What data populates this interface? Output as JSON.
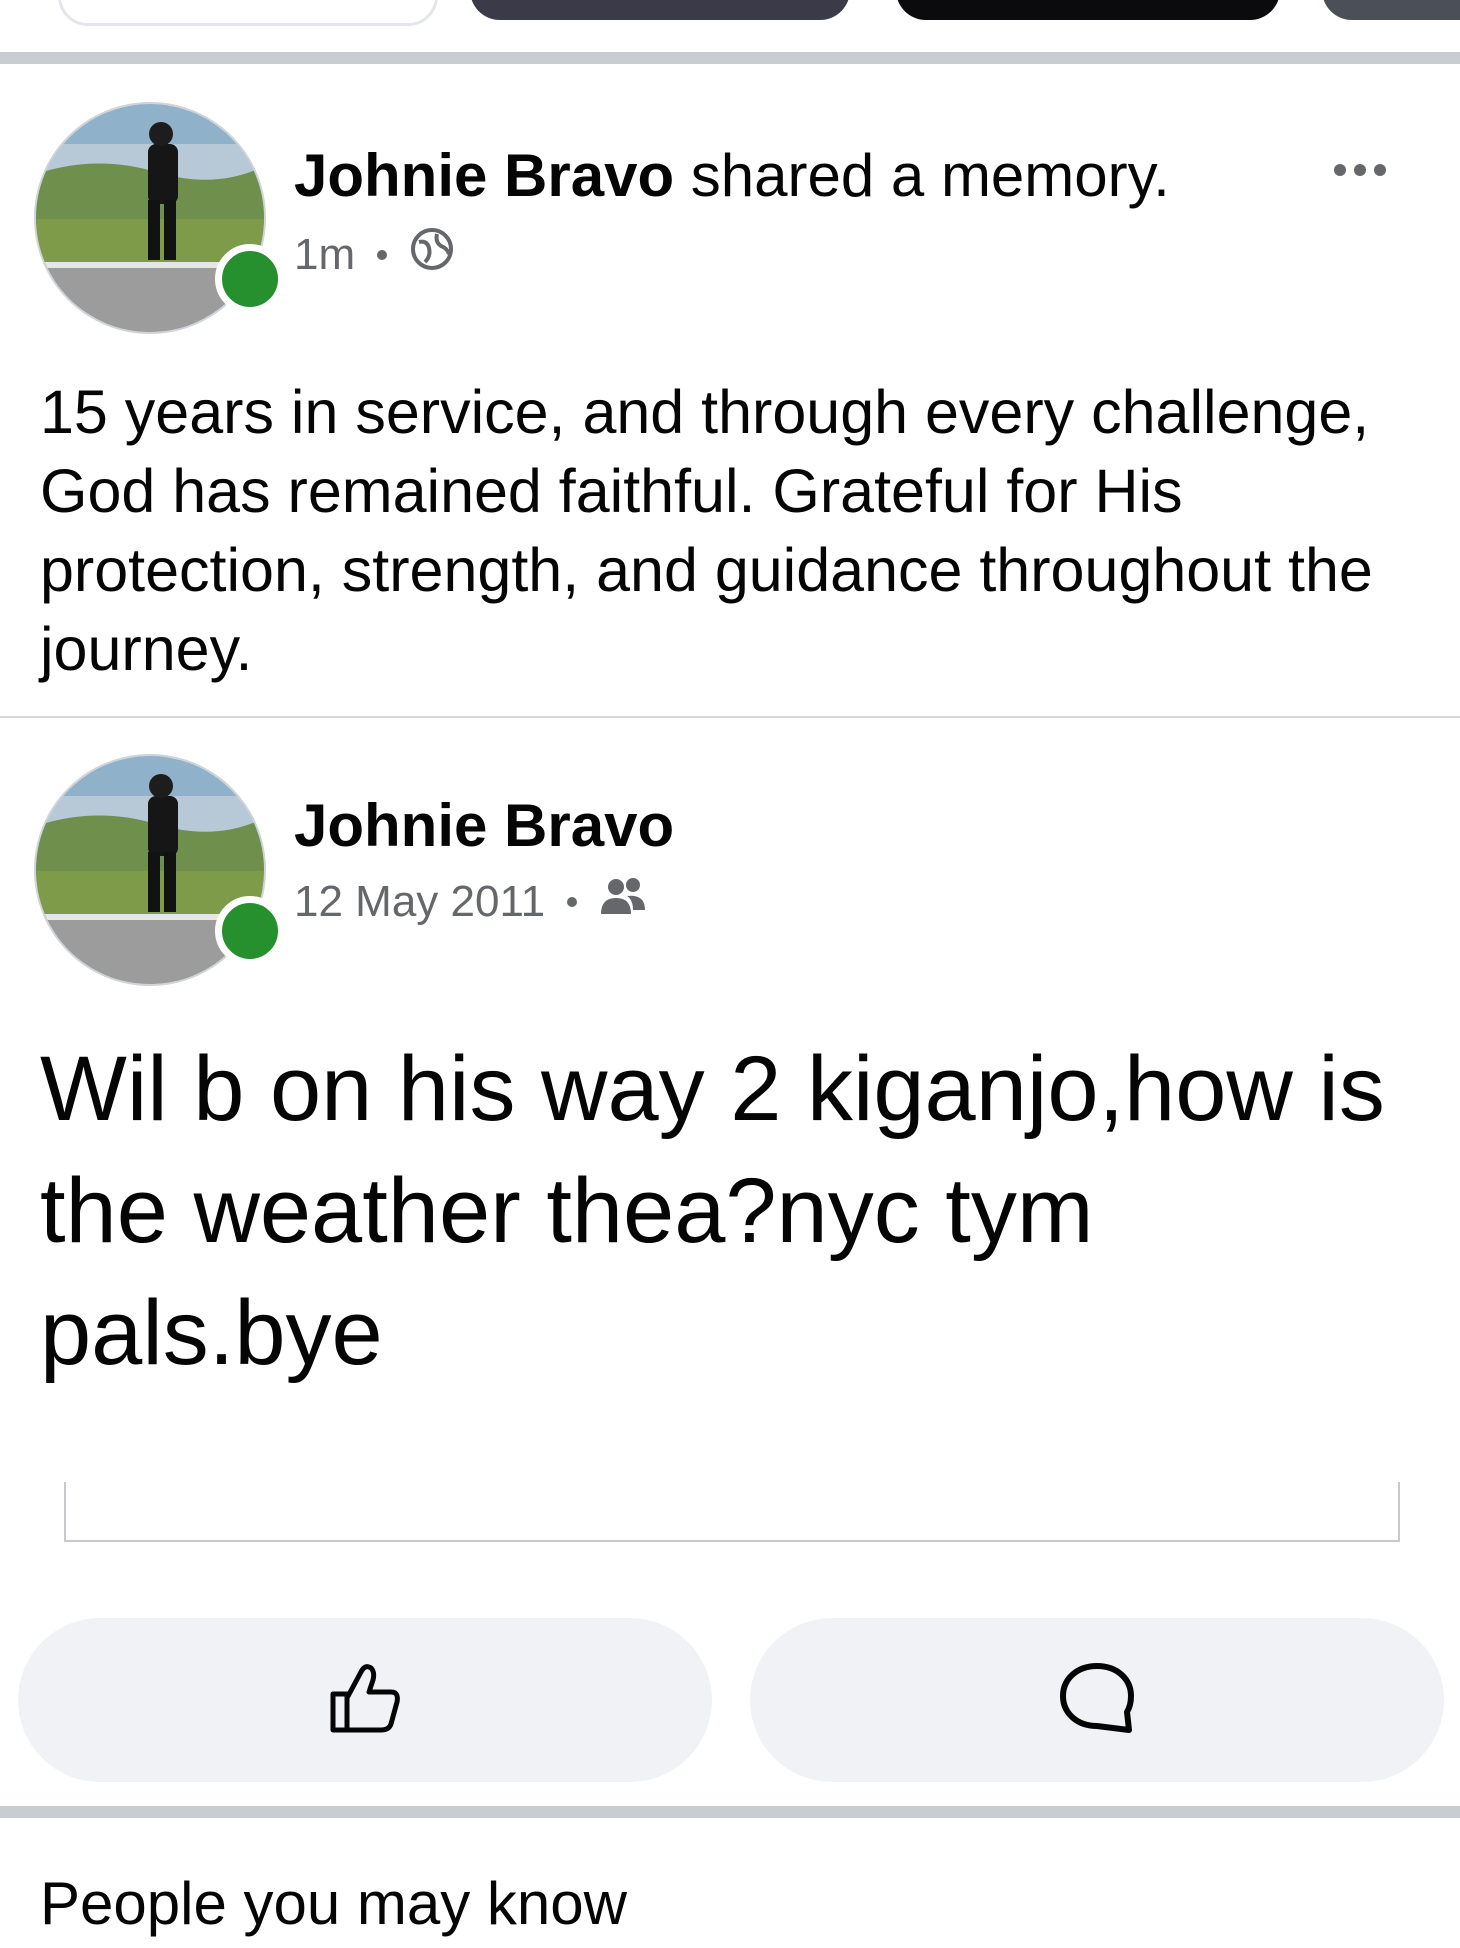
{
  "post1": {
    "author": "Johnie Bravo",
    "action_text": "shared a memory.",
    "time": "1m",
    "audience_icon": "globe-icon",
    "text": "15 years in service, and through every challenge, God has remained faithful. Grateful for His protection, strength, and guidance throughout the journey."
  },
  "post2": {
    "author": "Johnie Bravo",
    "date": "12 May 2011",
    "audience_icon": "friends-icon",
    "text": "Wil b on his way 2 kiganjo,how is the weather thea?nyc tym pals.bye"
  },
  "actions": {
    "like_icon": "thumbs-up-icon",
    "comment_icon": "comment-icon"
  },
  "colors": {
    "online": "#26902f",
    "meta": "#65676b",
    "button_bg": "#f0f2f5",
    "separator": "#c9ccd1"
  },
  "section": {
    "title": "People you may know"
  }
}
